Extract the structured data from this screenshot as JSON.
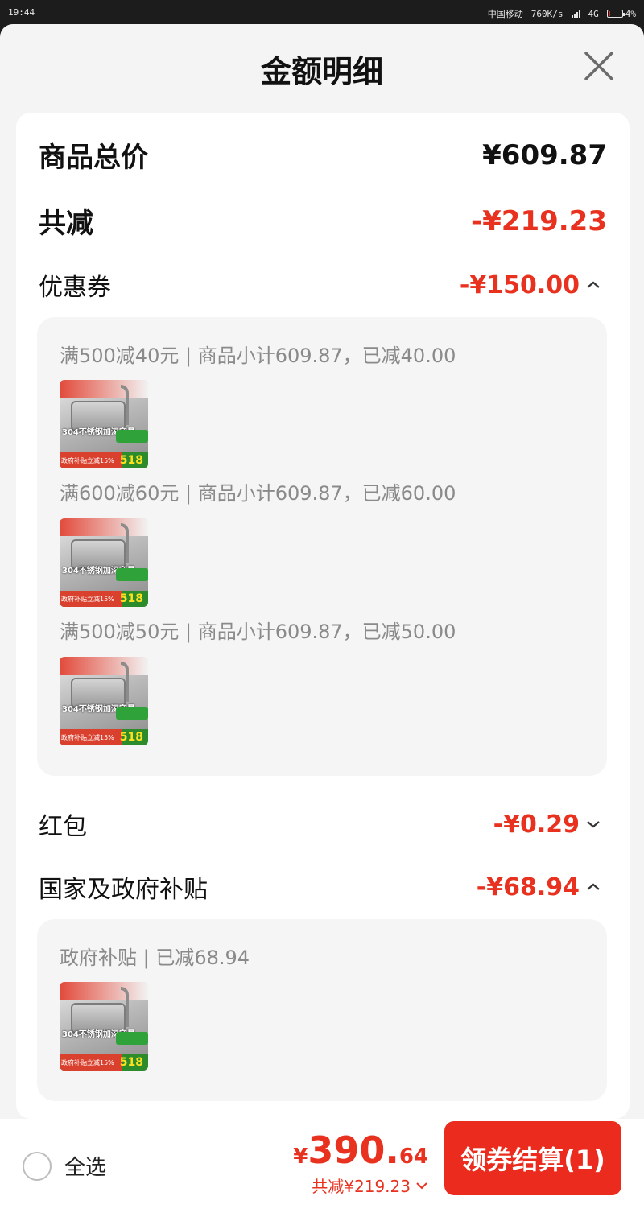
{
  "status_bar": {
    "time": "19:44",
    "carrier": "中国移动",
    "speed": "760K/s",
    "network": "4G",
    "battery": "4%"
  },
  "sheet": {
    "title": "金额明细"
  },
  "summary": {
    "total_label": "商品总价",
    "total_value": "¥609.87",
    "reduce_label": "共减",
    "reduce_value": "-¥219.23"
  },
  "coupon": {
    "label": "优惠券",
    "value": "-¥150.00",
    "items": [
      {
        "text": "满500减40元 | 商品小计609.87，已减40.00",
        "thumb_title": "304不锈钢加深容量",
        "thumb_sub": "政府补贴立减15%",
        "thumb_num": "518"
      },
      {
        "text": "满600减60元 | 商品小计609.87，已减60.00",
        "thumb_title": "304不锈钢加深容量",
        "thumb_sub": "政府补贴立减15%",
        "thumb_num": "518"
      },
      {
        "text": "满500减50元 | 商品小计609.87，已减50.00",
        "thumb_title": "304不锈钢加深容量",
        "thumb_sub": "政府补贴立减15%",
        "thumb_num": "518"
      }
    ]
  },
  "hongbao": {
    "label": "红包",
    "value": "-¥0.29"
  },
  "subsidy": {
    "label": "国家及政府补贴",
    "value": "-¥68.94",
    "items": [
      {
        "text": "政府补贴 | 已减68.94",
        "thumb_title": "304不锈钢加深容量",
        "thumb_sub": "政府补贴立减15%",
        "thumb_num": "518"
      }
    ]
  },
  "footer": {
    "select_all": "全选",
    "currency": "¥",
    "price_int": "390.",
    "price_dec": "64",
    "reduced": "共减¥219.23",
    "checkout": "领券结算(1)"
  },
  "colors": {
    "accent_red": "#e8321f",
    "button_red": "#ea2b1d",
    "sheet_bg": "#f4f4f4",
    "card_bg": "#ffffff"
  }
}
